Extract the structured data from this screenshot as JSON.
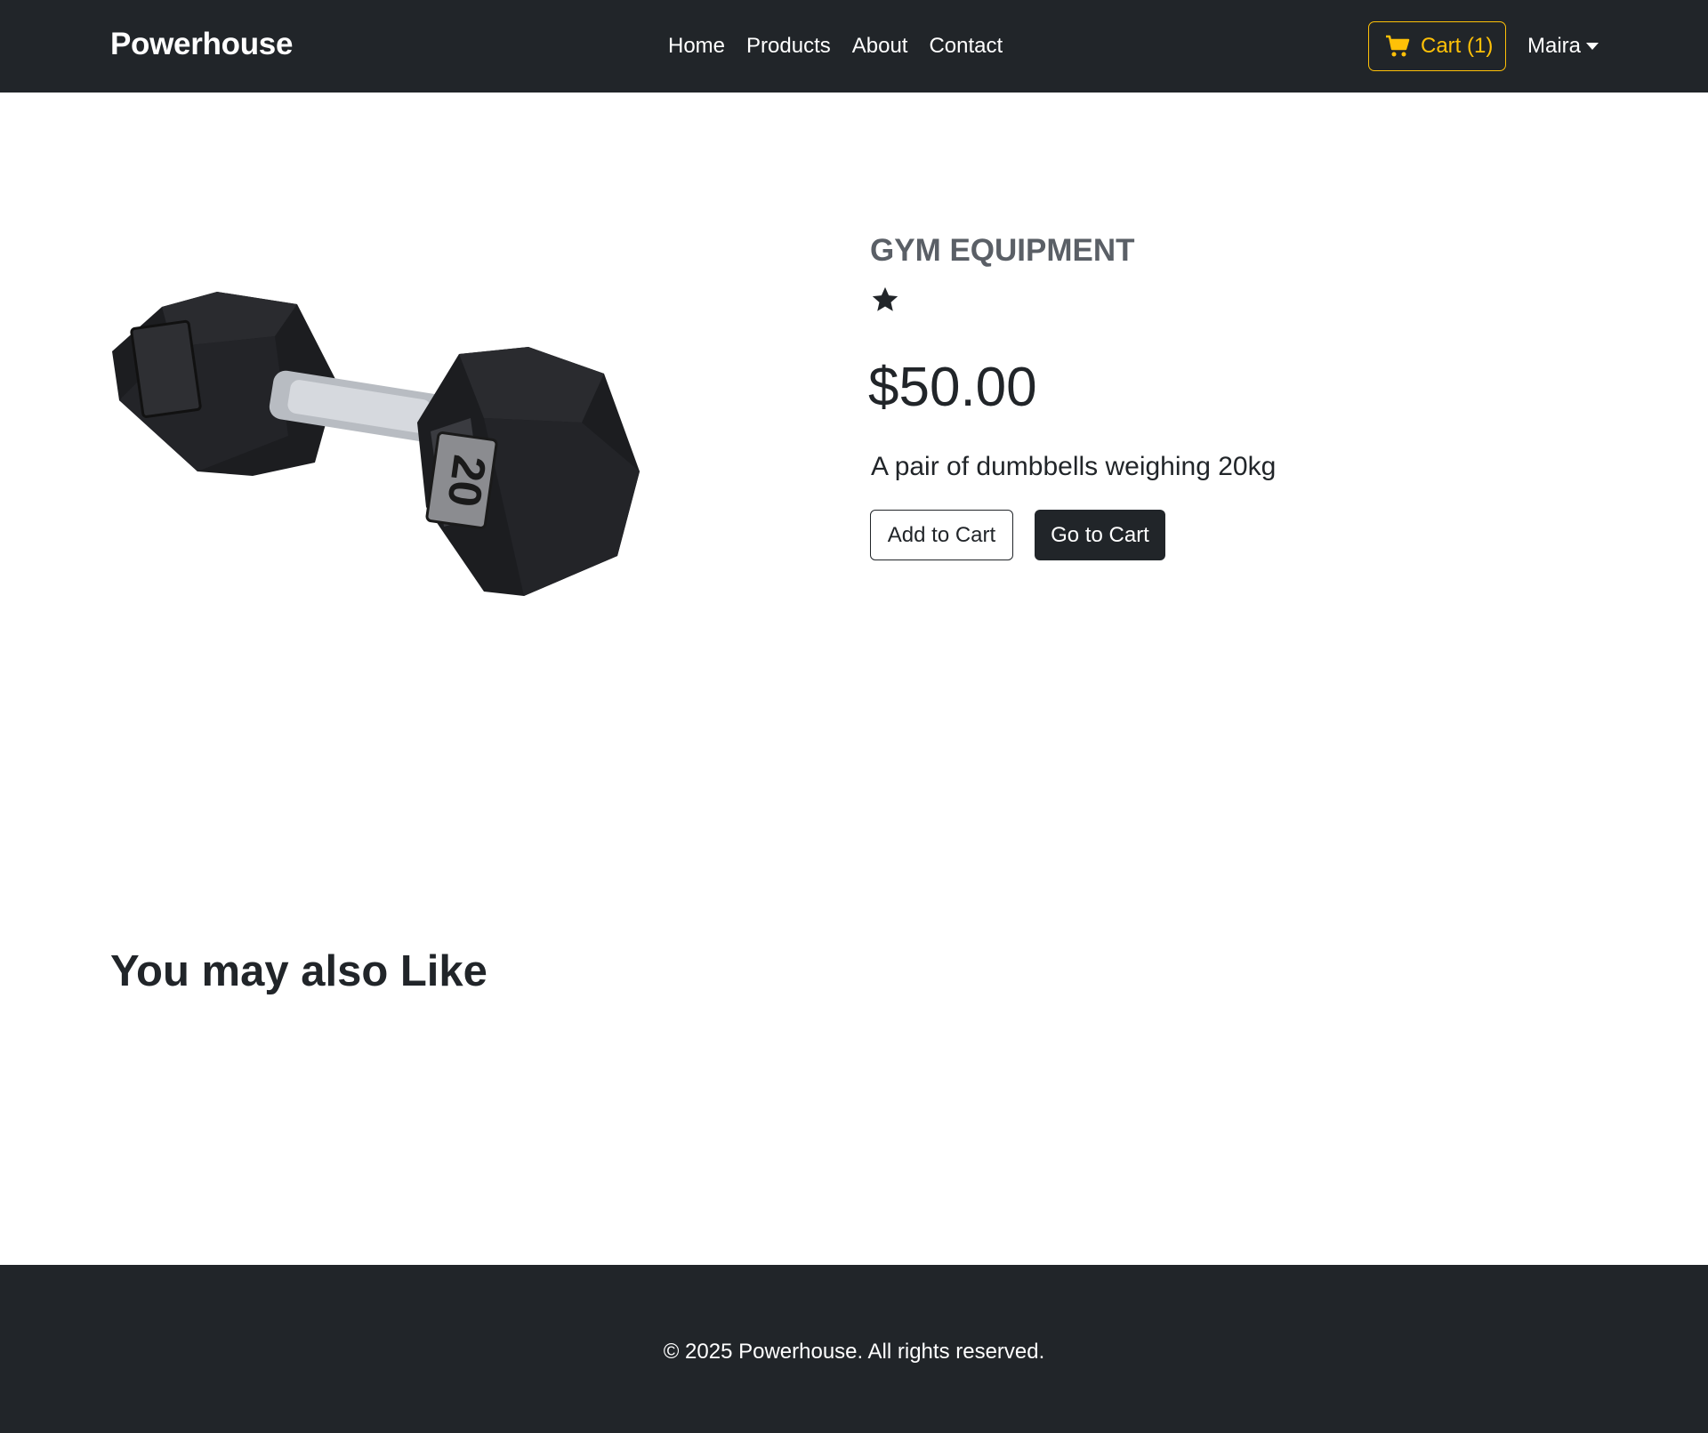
{
  "navbar": {
    "brand": "Powerhouse",
    "links": [
      {
        "label": "Home"
      },
      {
        "label": "Products"
      },
      {
        "label": "About"
      },
      {
        "label": "Contact"
      }
    ],
    "cart_label": "Cart (1)",
    "cart_icon": "cart-icon",
    "user_name": "Maira",
    "accent_color": "#ffc107",
    "background_color": "#212529"
  },
  "product": {
    "category": "GYM EQUIPMENT",
    "rating": 1,
    "rating_icon": "star-icon",
    "price": "$50.00",
    "description": "A pair of dumbbells weighing 20kg",
    "image_label": "20",
    "add_to_cart_label": "Add to Cart",
    "go_to_cart_label": "Go to Cart"
  },
  "recommendations": {
    "title": "You may also Like"
  },
  "footer": {
    "text": "© 2025 Powerhouse. All rights reserved."
  }
}
